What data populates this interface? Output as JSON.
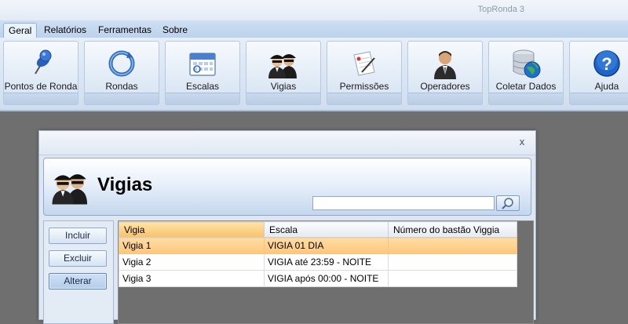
{
  "app": {
    "title": "TopRonda 3"
  },
  "ribbon_tabs": [
    {
      "label": "Geral",
      "active": true
    },
    {
      "label": "Relatórios",
      "active": false
    },
    {
      "label": "Ferramentas",
      "active": false
    },
    {
      "label": "Sobre",
      "active": false
    }
  ],
  "ribbon_buttons": [
    {
      "label": "Pontos de Ronda",
      "icon": "pushpin-icon"
    },
    {
      "label": "Rondas",
      "icon": "refresh-circle-icon"
    },
    {
      "label": "Escalas",
      "icon": "calendar-icon"
    },
    {
      "label": "Vigias",
      "icon": "guards-icon"
    },
    {
      "label": "Permissões",
      "icon": "document-pen-icon"
    },
    {
      "label": "Operadores",
      "icon": "operator-icon"
    },
    {
      "label": "Coletar Dados",
      "icon": "database-globe-icon"
    },
    {
      "label": "Ajuda",
      "icon": "help-icon"
    }
  ],
  "dialog": {
    "close_label": "x",
    "title": "Vigias",
    "search": {
      "value": "",
      "placeholder": ""
    },
    "actions": {
      "include": "Incluir",
      "delete": "Excluir",
      "edit": "Alterar"
    },
    "grid": {
      "columns": [
        "Vigia",
        "Escala",
        "Número do bastão Viggia"
      ],
      "rows": [
        [
          "Vigia 1",
          "VIGIA 01  DIA",
          ""
        ],
        [
          "Vigia 2",
          "VIGIA até 23:59 - NOITE",
          ""
        ],
        [
          "Vigia 3",
          "VIGIA após 00:00 - NOITE",
          ""
        ]
      ],
      "selected_row": 0
    }
  },
  "colors": {
    "selection": "#ffc77a",
    "ribbon": "#cfdeef",
    "workspace": "#6f6f6f"
  }
}
